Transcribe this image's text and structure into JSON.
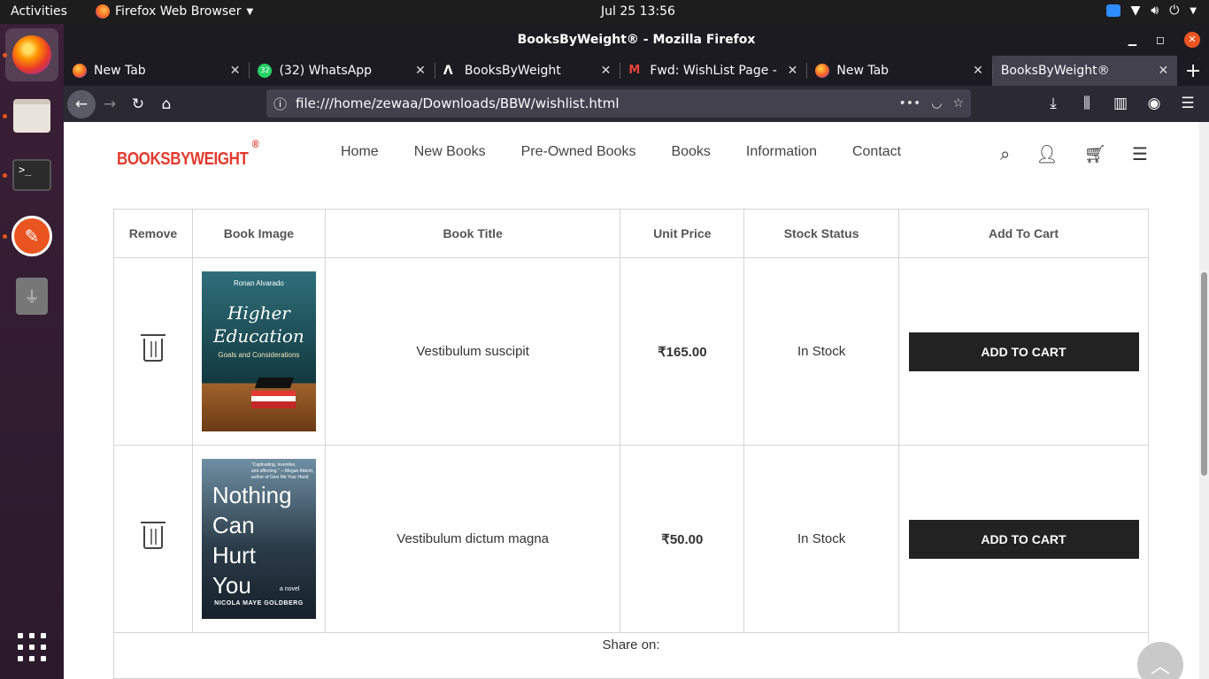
{
  "topbar": {
    "activities": "Activities",
    "app_name": "Firefox Web Browser",
    "clock": "Jul 25  13:56"
  },
  "window": {
    "title": "BooksByWeight® - Mozilla Firefox"
  },
  "tabs": [
    {
      "label": "New Tab",
      "icon": "firefox-icon"
    },
    {
      "label": "(32) WhatsApp",
      "icon": "whatsapp-icon",
      "badge": "32"
    },
    {
      "label": "BooksByWeight",
      "icon": "a-icon"
    },
    {
      "label": "Fwd: WishList Page - a",
      "icon": "gmail-icon"
    },
    {
      "label": "New Tab",
      "icon": "firefox-icon"
    },
    {
      "label": "BooksByWeight®",
      "icon": "",
      "active": true
    }
  ],
  "urlbar": {
    "url": "file:///home/zewaa/Downloads/BBW/wishlist.html"
  },
  "site": {
    "logo": "BOOKSBYWEIGHT",
    "logo_mark": "®",
    "nav": [
      "Home",
      "New Books",
      "Pre-Owned Books",
      "Books",
      "Information",
      "Contact"
    ]
  },
  "wishlist": {
    "headers": [
      "Remove",
      "Book Image",
      "Book Title",
      "Unit Price",
      "Stock Status",
      "Add To Cart"
    ],
    "rows": [
      {
        "title": "Vestibulum suscipit",
        "price": "₹165.00",
        "stock": "In Stock",
        "button": "ADD TO CART",
        "cover": {
          "author": "Ronan Alvarado",
          "title_line1": "Higher",
          "title_line2": "Education",
          "subtitle": "Goals and Considerations"
        }
      },
      {
        "title": "Vestibulum dictum magna",
        "price": "₹50.00",
        "stock": "In Stock",
        "button": "ADD TO CART",
        "cover": {
          "quote_line1": "\"Captivating, inventive,",
          "quote_line2": "and affecting.\" —Megan Abbott,",
          "quote_line3": "author of Give Me Your Hand",
          "title_line1": "Nothing",
          "title_line2": "Can",
          "title_line3": "Hurt",
          "title_line4": "You",
          "novel": "a novel",
          "author": "NICOLA MAYE GOLDBERG"
        }
      }
    ],
    "share_label": "Share on:"
  },
  "colors": {
    "brand": "#e33b2e",
    "button": "#222222",
    "ubuntu_accent": "#e95420"
  }
}
